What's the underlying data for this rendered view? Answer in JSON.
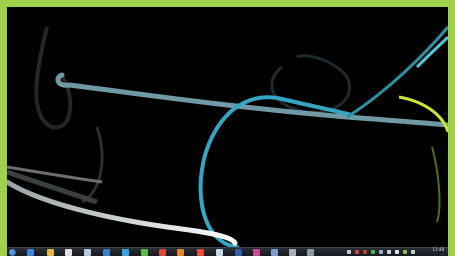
{
  "taskbar": {
    "items": [
      {
        "name": "start-button",
        "color": "#1a4e9c"
      },
      {
        "name": "internet-explorer-icon",
        "color": "#3f86d6"
      },
      {
        "name": "folder-icon",
        "color": "#e0b84a"
      },
      {
        "name": "media-player-icon",
        "color": "#e0e0e0"
      },
      {
        "name": "document-icon",
        "color": "#b9c7d6"
      },
      {
        "name": "app-icon-blue",
        "color": "#3d7fc9"
      },
      {
        "name": "skype-icon",
        "color": "#2fa6e3"
      },
      {
        "name": "green-app-icon",
        "color": "#5db84a"
      },
      {
        "name": "flag-icon",
        "color": "#d94a3a"
      },
      {
        "name": "orange-app-icon",
        "color": "#e08a2a"
      },
      {
        "name": "chrome-icon",
        "color": "#e44b3c"
      },
      {
        "name": "mail-icon",
        "color": "#c9d6e6"
      },
      {
        "name": "word-icon",
        "color": "#2d5fa8"
      },
      {
        "name": "paint-icon",
        "color": "#c54a9a"
      },
      {
        "name": "screen-app-icon",
        "color": "#7aa0c8"
      },
      {
        "name": "window-app-icon",
        "color": "#a6b0bc"
      },
      {
        "name": "window-app-icon-2",
        "color": "#8e98a4"
      }
    ],
    "tray": [
      {
        "name": "tray-arrow-icon",
        "color": "#c8cdd3"
      },
      {
        "name": "tray-red-icon",
        "color": "#d9453a"
      },
      {
        "name": "tray-red-icon-2",
        "color": "#c9362c"
      },
      {
        "name": "tray-green-icon",
        "color": "#56b34a"
      },
      {
        "name": "tray-network-icon",
        "color": "#9fb3c8"
      },
      {
        "name": "tray-volume-icon",
        "color": "#d0d5da"
      },
      {
        "name": "tray-flag-icon",
        "color": "#e6e9ec"
      },
      {
        "name": "tray-battery-icon",
        "color": "#8bc34a"
      },
      {
        "name": "tray-speaker-icon",
        "color": "#c6ccd2"
      }
    ],
    "clock": {
      "time": "13:48",
      "date": "..."
    }
  }
}
